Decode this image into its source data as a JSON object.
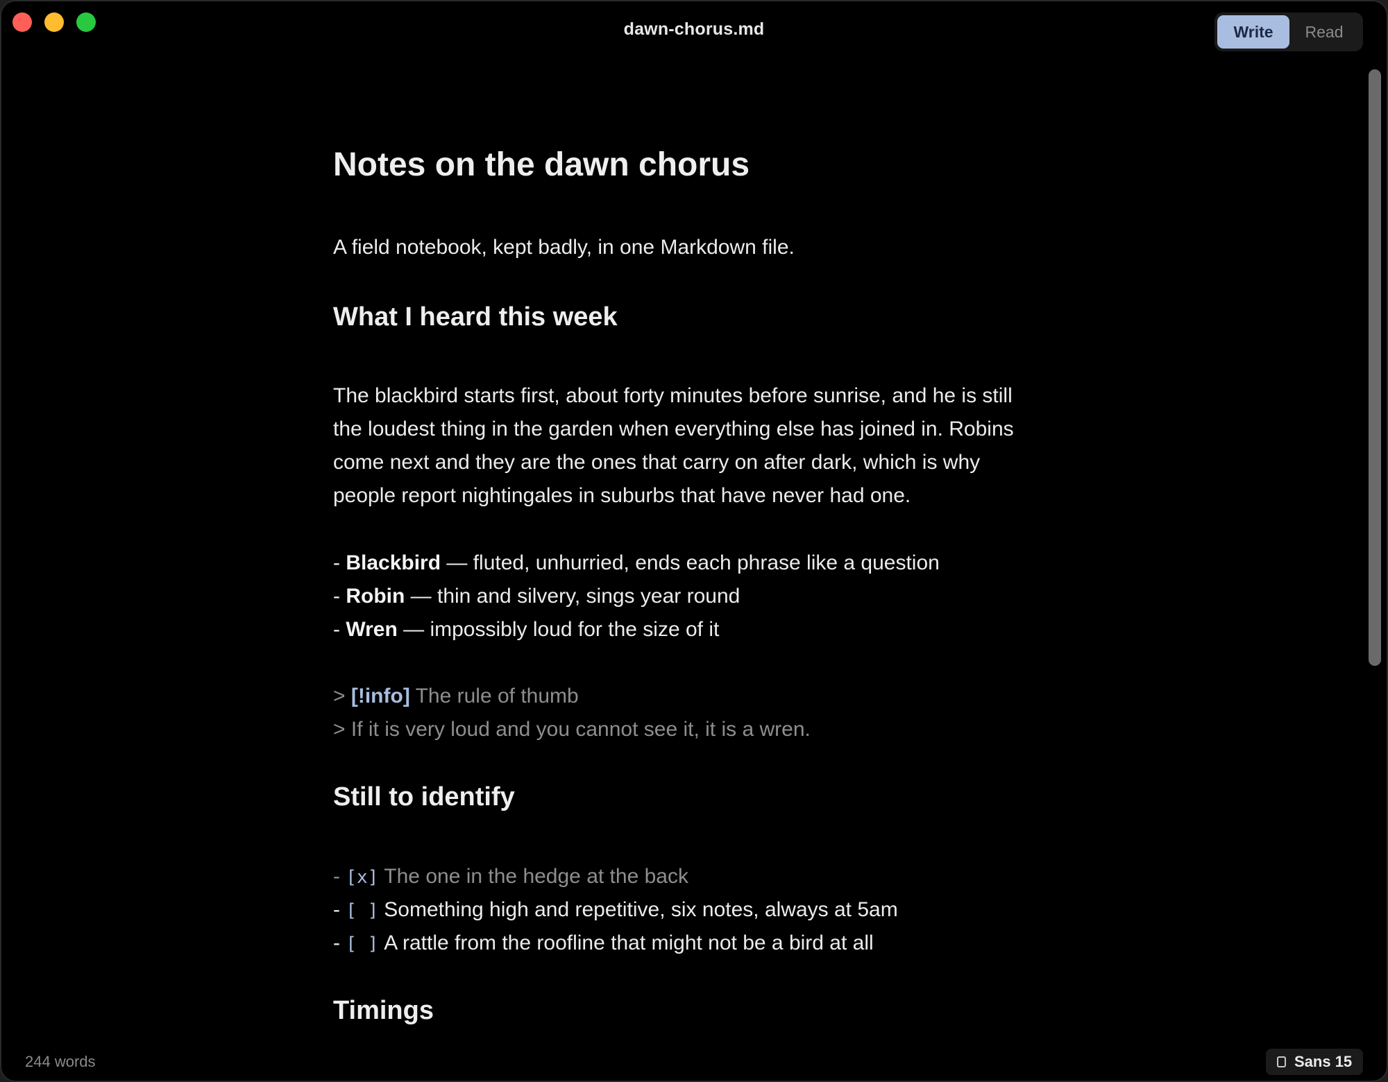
{
  "window": {
    "title": "dawn-chorus.md",
    "modes": {
      "write": "Write",
      "read": "Read"
    }
  },
  "document": {
    "h1": "Notes on the dawn chorus",
    "intro": "A field notebook, kept badly, in one Markdown file.",
    "section1": {
      "heading": "What I heard this week",
      "paragraph": "The blackbird starts first, about forty minutes before sunrise, and he is still the loudest thing in the garden when everything else has joined in. Robins come next and they are the ones that carry on after dark, which is why people report nightingales in suburbs that have never had one.",
      "birds": [
        {
          "prefix": "- ",
          "name": "Blackbird",
          "desc": " — fluted, unhurried, ends each phrase like a question"
        },
        {
          "prefix": "- ",
          "name": "Robin",
          "desc": " — thin and silvery, sings year round"
        },
        {
          "prefix": "- ",
          "name": "Wren",
          "desc": " — impossibly loud for the size of it"
        }
      ],
      "callout": {
        "marker": "> ",
        "tag": "[!info]",
        "title": " The rule of thumb",
        "body": "> If it is very loud and you cannot see it, it is a wren."
      }
    },
    "section2": {
      "heading": "Still to identify",
      "tasks": [
        {
          "prefix": "- ",
          "box": "[x]",
          "text": "The one in the hedge at the back",
          "done": true
        },
        {
          "prefix": "- ",
          "box": "[ ]",
          "text": "Something high and repetitive, six notes, always at 5am",
          "done": false
        },
        {
          "prefix": "- ",
          "box": "[ ]",
          "text": "A rattle from the roofline that might not be a bird at all",
          "done": false
        }
      ]
    },
    "section3": {
      "heading": "Timings"
    }
  },
  "status": {
    "word_count": "244 words",
    "font": "Sans 15"
  }
}
